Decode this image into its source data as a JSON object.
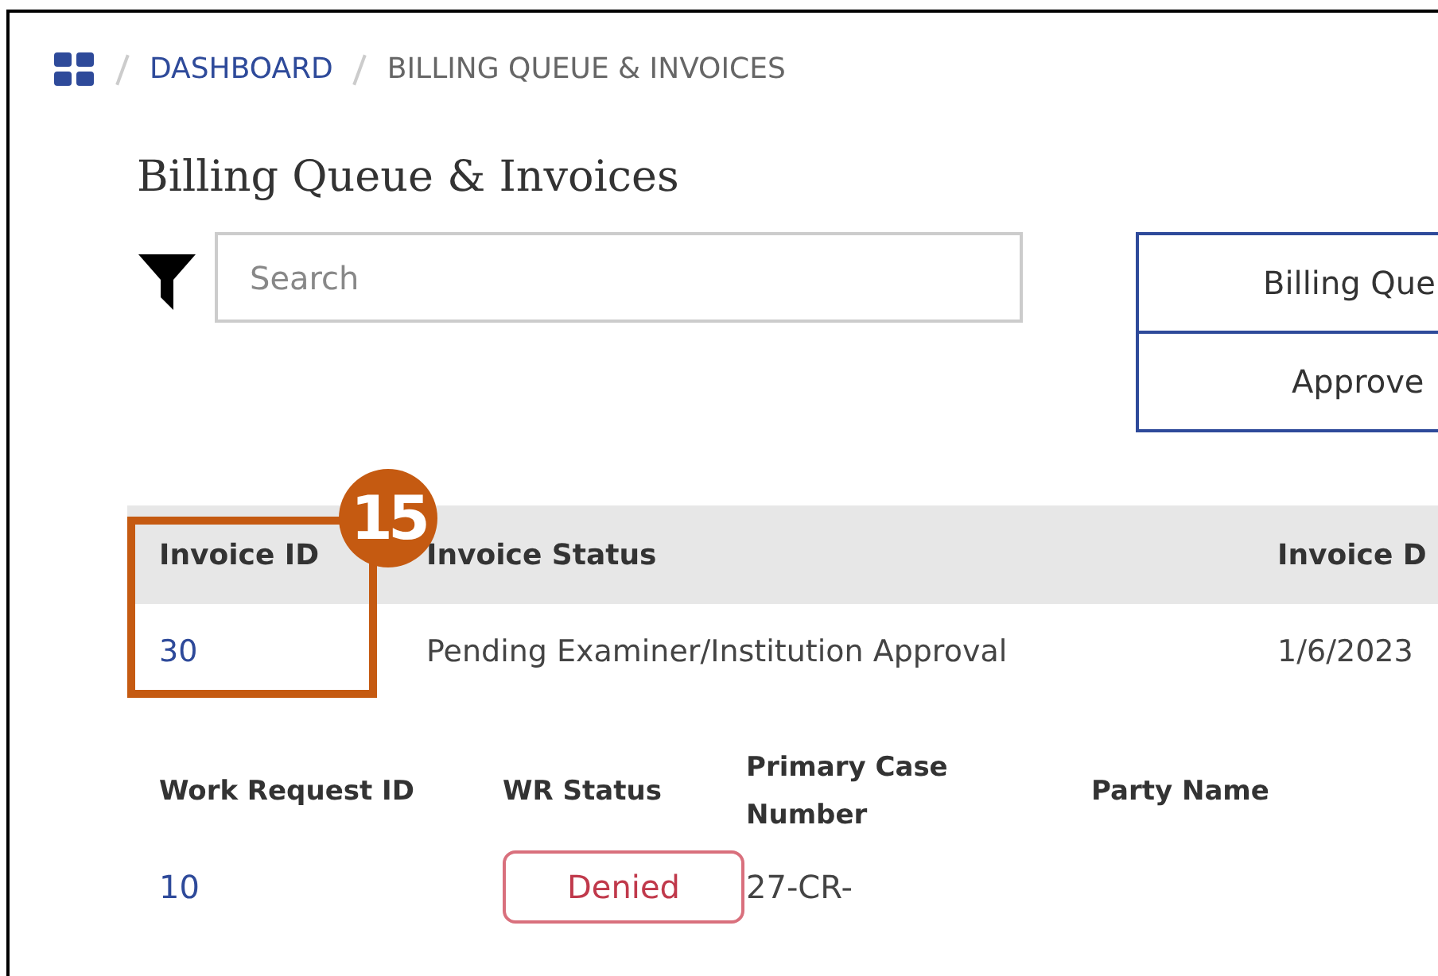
{
  "breadcrumb": [
    {
      "label": "DASHBOARD",
      "kind": "link"
    },
    {
      "label": "BILLING QUEUE & INVOICES",
      "kind": "current"
    }
  ],
  "title": "Billing Queue & Invoices",
  "search": {
    "placeholder": "Search"
  },
  "view_buttons": [
    "Billing Que",
    "Approve"
  ],
  "invoice_table": {
    "columns": [
      "Invoice ID",
      "Invoice Status",
      "Invoice D"
    ],
    "rows": [
      [
        "30",
        "Pending Examiner/Institution Approval",
        "1/6/2023"
      ]
    ]
  },
  "work_request_table": {
    "columns": [
      "Work Request ID",
      "WR Status",
      "Primary Case Number",
      "Party Name"
    ],
    "rows": [
      [
        "10",
        "Denied",
        "27-CR-",
        ""
      ]
    ]
  },
  "callout": {
    "number": "15"
  }
}
